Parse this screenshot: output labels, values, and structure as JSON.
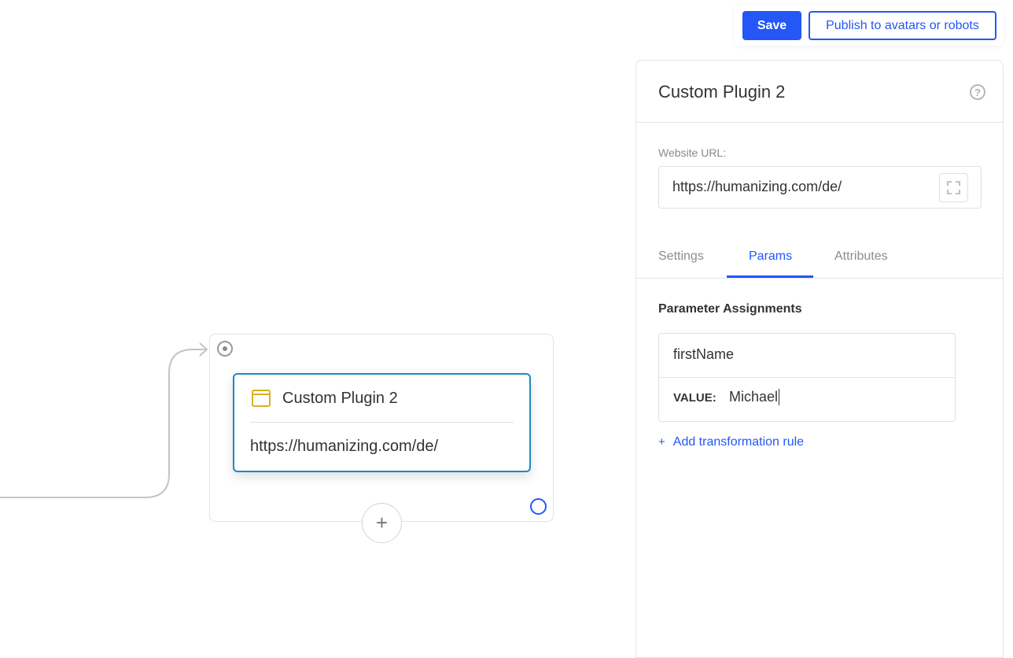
{
  "toolbar": {
    "save_label": "Save",
    "publish_label": "Publish to avatars or robots"
  },
  "canvas": {
    "node": {
      "icon": "browser-window-icon",
      "title": "Custom Plugin 2",
      "url": "https://humanizing.com/de/"
    },
    "add_node_symbol": "+"
  },
  "panel": {
    "title": "Custom Plugin 2",
    "help_symbol": "?",
    "url_label": "Website URL:",
    "url_value": "https://humanizing.com/de/",
    "tabs": [
      {
        "label": "Settings",
        "active": false
      },
      {
        "label": "Params",
        "active": true
      },
      {
        "label": "Attributes",
        "active": false
      }
    ],
    "section_title": "Parameter Assignments",
    "param": {
      "name": "firstName",
      "value_label": "VALUE:",
      "value": "Michael"
    },
    "add_rule_symbol": "+",
    "add_rule_label": "Add transformation rule"
  },
  "colors": {
    "accent": "#2457f5",
    "node_border": "#1a8bc4",
    "node_icon": "#d9b024"
  }
}
